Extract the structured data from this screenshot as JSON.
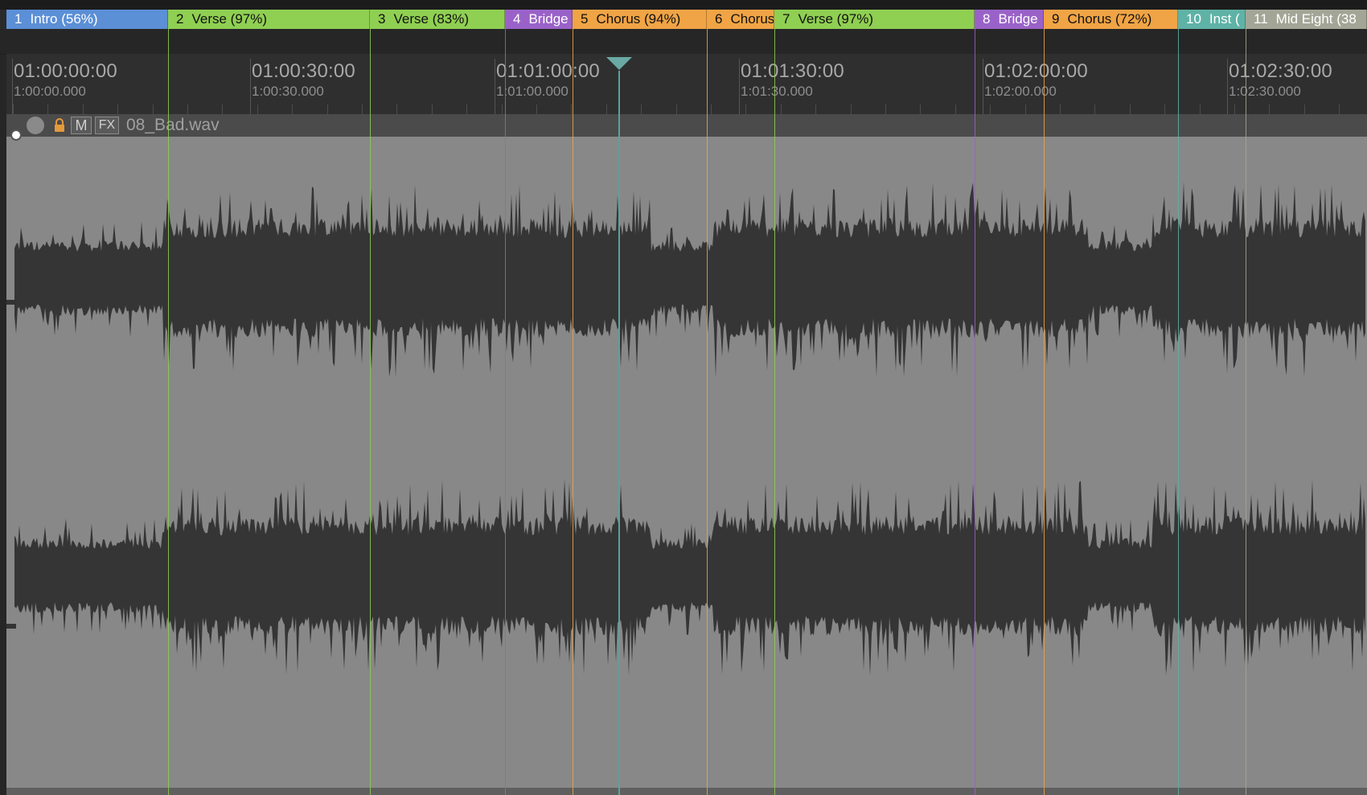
{
  "clip": {
    "name": "08_Bad.wav"
  },
  "track_header": {
    "mute_label": "M",
    "fx_label": "FX"
  },
  "sections": [
    {
      "number": "1",
      "label": "Intro (56%)",
      "color": "#5b8fd6",
      "text_color": "#ffffff"
    },
    {
      "number": "2",
      "label": "Verse (97%)",
      "color": "#8fcf52",
      "text_color": "#111111"
    },
    {
      "number": "3",
      "label": "Verse (83%)",
      "color": "#8fcf52",
      "text_color": "#111111"
    },
    {
      "number": "4",
      "label": "Bridge",
      "color": "#9a62c8",
      "text_color": "#ffffff"
    },
    {
      "number": "5",
      "label": "Chorus (94%)",
      "color": "#f0a445",
      "text_color": "#111111"
    },
    {
      "number": "6",
      "label": "Chorus",
      "color": "#f0a445",
      "text_color": "#111111"
    },
    {
      "number": "7",
      "label": "Verse (97%)",
      "color": "#8fcf52",
      "text_color": "#111111"
    },
    {
      "number": "8",
      "label": "Bridge",
      "color": "#9a62c8",
      "text_color": "#ffffff"
    },
    {
      "number": "9",
      "label": "Chorus (72%)",
      "color": "#f0a445",
      "text_color": "#111111"
    },
    {
      "number": "10",
      "label": "Inst (",
      "color": "#5fb2a6",
      "text_color": "#ffffff"
    },
    {
      "number": "11",
      "label": "Mid Eight (38",
      "color": "#a3a696",
      "text_color": "#ffffff"
    }
  ],
  "ruler": [
    {
      "timecode": "01:00:00:00",
      "seconds": "1:00:00.000"
    },
    {
      "timecode": "01:00:30:00",
      "seconds": "1:00:30.000"
    },
    {
      "timecode": "01:01:00:00",
      "seconds": "1:01:00.000"
    },
    {
      "timecode": "01:01:30:00",
      "seconds": "1:01:30.000"
    },
    {
      "timecode": "01:02:00:00",
      "seconds": "1:02:00.000"
    },
    {
      "timecode": "01:02:30:00",
      "seconds": "1:02:30.000"
    }
  ],
  "colors": {
    "waveform": "#353535",
    "track_bg": "#888888",
    "playhead": "#5aa39c"
  }
}
